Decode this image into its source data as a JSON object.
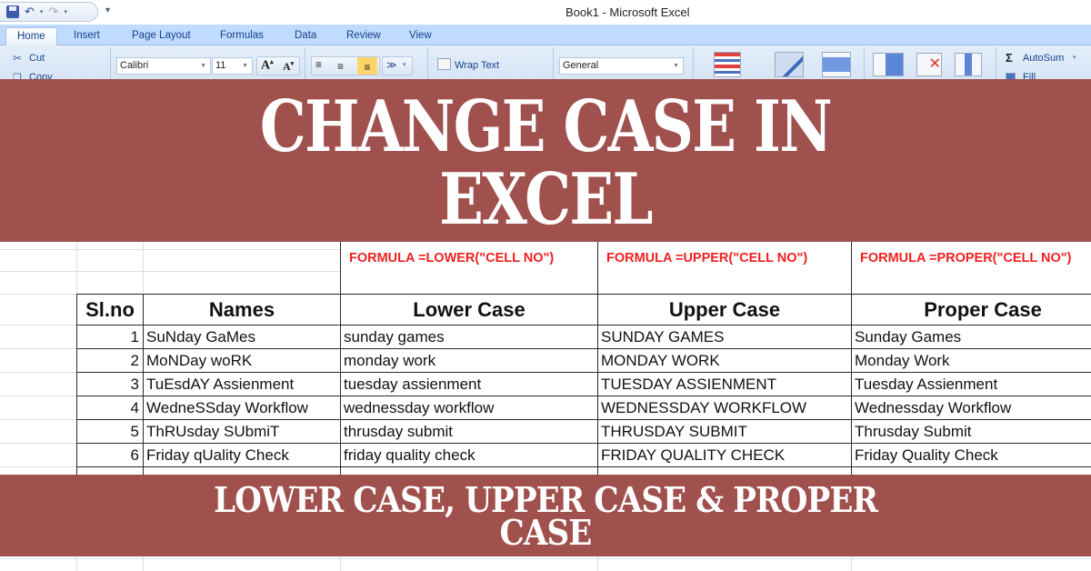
{
  "window": {
    "title": "Book1  -  Microsoft Excel",
    "quick_access": [
      "save-icon",
      "undo-icon",
      "redo-icon",
      "customize-icon"
    ]
  },
  "tabs": [
    {
      "label": "Home",
      "active": true
    },
    {
      "label": "Insert"
    },
    {
      "label": "Page Layout"
    },
    {
      "label": "Formulas"
    },
    {
      "label": "Data"
    },
    {
      "label": "Review"
    },
    {
      "label": "View"
    }
  ],
  "ribbon": {
    "cut": "Cut",
    "copy": "Copy",
    "font_name": "Calibri",
    "font_size": "11",
    "wrap_text": "Wrap Text",
    "number_format": "General",
    "autosum": "AutoSum",
    "fill": "Fill",
    "sigma": "Σ"
  },
  "banner_top": {
    "line1": "CHANGE CASE IN",
    "line2": "EXCEL",
    "color": "#a0504d"
  },
  "banner_bottom": {
    "line1": "LOWER CASE, UPPER CASE & PROPER",
    "line2": "CASE"
  },
  "sheet": {
    "formulas": {
      "lower": "FORMULA =LOWER(\"CELL NO\")",
      "upper": "FORMULA =UPPER(\"CELL NO\")",
      "proper": "FORMULA =PROPER(\"CELL NO\")"
    },
    "headers": {
      "slno": "Sl.no",
      "names": "Names",
      "lower": "Lower Case",
      "upper": "Upper Case",
      "proper": "Proper Case"
    },
    "rows": [
      {
        "no": "1",
        "name": "SuNday GaMes",
        "lower": "sunday games",
        "upper": "SUNDAY GAMES",
        "proper": "Sunday Games"
      },
      {
        "no": "2",
        "name": "MoNDay woRK",
        "lower": "monday work",
        "upper": "MONDAY WORK",
        "proper": "Monday Work"
      },
      {
        "no": "3",
        "name": "TuEsdAY Assienment",
        "lower": "tuesday assienment",
        "upper": "TUESDAY ASSIENMENT",
        "proper": "Tuesday Assienment"
      },
      {
        "no": "4",
        "name": "WedneSSday Workflow",
        "lower": "wednessday workflow",
        "upper": "WEDNESSDAY WORKFLOW",
        "proper": "Wednessday Workflow"
      },
      {
        "no": "5",
        "name": "ThRUsday SUbmiT",
        "lower": "thrusday submit",
        "upper": "THRUSDAY SUBMIT",
        "proper": "Thrusday Submit"
      },
      {
        "no": "6",
        "name": "Friday qUality Check",
        "lower": "friday quality check",
        "upper": "FRIDAY QUALITY CHECK",
        "proper": "Friday Quality Check"
      }
    ],
    "formula_color": "#f21f1f"
  }
}
